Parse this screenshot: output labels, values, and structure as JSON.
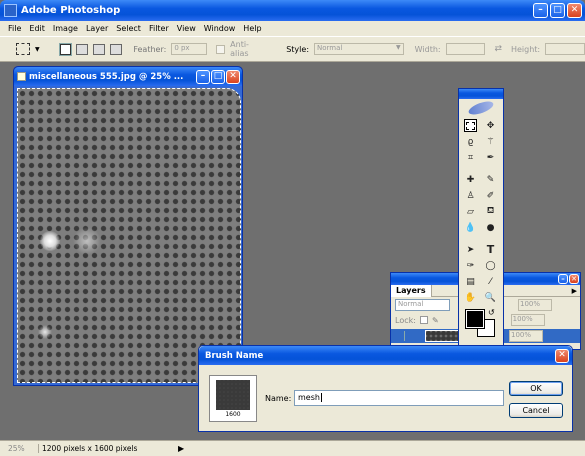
{
  "app": {
    "title": "Adobe Photoshop"
  },
  "menu": [
    "File",
    "Edit",
    "Image",
    "Layer",
    "Select",
    "Filter",
    "View",
    "Window",
    "Help"
  ],
  "options": {
    "feather_label": "Feather:",
    "feather_value": "0 px",
    "antialias_label": "Anti-alias",
    "style_label": "Style:",
    "style_value": "Normal",
    "width_label": "Width:",
    "height_label": "Height:"
  },
  "document": {
    "title": "miscellaneous 555.jpg @ 25% ..."
  },
  "layers": {
    "title": "Layers",
    "blend_mode": "Normal",
    "opacity_value": "100%",
    "lock_label": "Lock:",
    "fill_value": "100%",
    "extra_value": "100%"
  },
  "dialog": {
    "title": "Brush Name",
    "preview_caption": "1600",
    "name_label": "Name:",
    "name_value": "mesh",
    "ok_label": "OK",
    "cancel_label": "Cancel"
  },
  "status": {
    "zoom": "25%",
    "info": "1200 pixels x 1600 pixels"
  }
}
